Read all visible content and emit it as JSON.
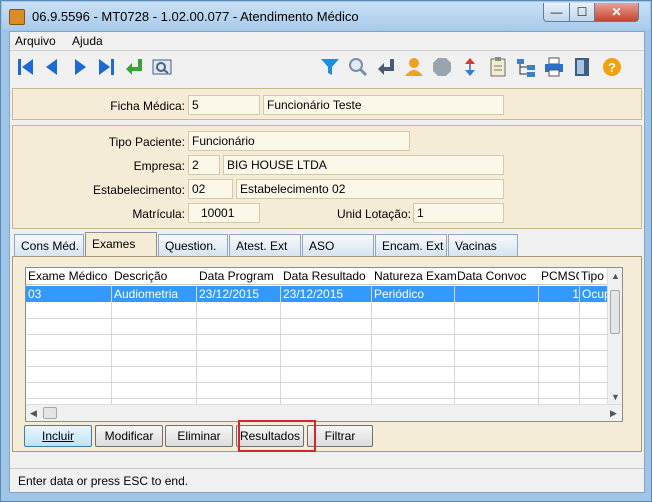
{
  "window": {
    "title": "06.9.5596 - MT0728 - 1.02.00.077 - Atendimento Médico",
    "min_glyph": "—",
    "max_glyph": "☐",
    "close_glyph": "✕"
  },
  "menu": {
    "items": [
      "Arquivo",
      "Ajuda"
    ]
  },
  "toolbar": {
    "icons": [
      "first-icon",
      "prev-icon",
      "next-icon",
      "last-icon",
      "return-icon",
      "zoom-icon",
      "filter-icon",
      "search-icon",
      "enter-icon",
      "user-icon",
      "stop-icon",
      "refresh-icon",
      "clipboard-icon",
      "tree-icon",
      "print-icon",
      "exit-icon",
      "help-icon"
    ]
  },
  "header": {
    "ficha_label": "Ficha Médica:",
    "ficha_code": "5",
    "ficha_name": "Funcionário Teste"
  },
  "details": {
    "tipo_label": "Tipo Paciente:",
    "tipo_value": "Funcionário",
    "empresa_label": "Empresa:",
    "empresa_code": "2",
    "empresa_name": "BIG HOUSE LTDA",
    "estab_label": "Estabelecimento:",
    "estab_code": "02",
    "estab_name": "Estabelecimento 02",
    "matricula_label": "Matrícula:",
    "matricula_value": "10001",
    "lotacao_label": "Unid Lotação:",
    "lotacao_value": "1"
  },
  "tabs": [
    "Cons Méd.",
    "Exames",
    "Question.",
    "Atest. Ext",
    "ASO",
    "Encam. Ext",
    "Vacinas"
  ],
  "active_tab": "Exames",
  "grid": {
    "columns": [
      "Exame Médico",
      "Descrição",
      "Data Program",
      "Data Resultado",
      "Natureza Exame",
      "Data Convoc",
      "PCMSO",
      "Tipo E"
    ],
    "rows": [
      [
        "03",
        "Audiometria",
        "23/12/2015",
        "23/12/2015",
        "Periódico",
        "",
        "1",
        "Ocup"
      ]
    ]
  },
  "buttons": {
    "incluir": "Incluir",
    "modificar": "Modificar",
    "eliminar": "Eliminar",
    "resultados": "Resultados",
    "filtrar": "Filtrar"
  },
  "status": "Enter data or press ESC to end.",
  "colors": {
    "accent": "#3399ff",
    "highlight": "#d8262b",
    "panel": "#f5ecd7"
  }
}
